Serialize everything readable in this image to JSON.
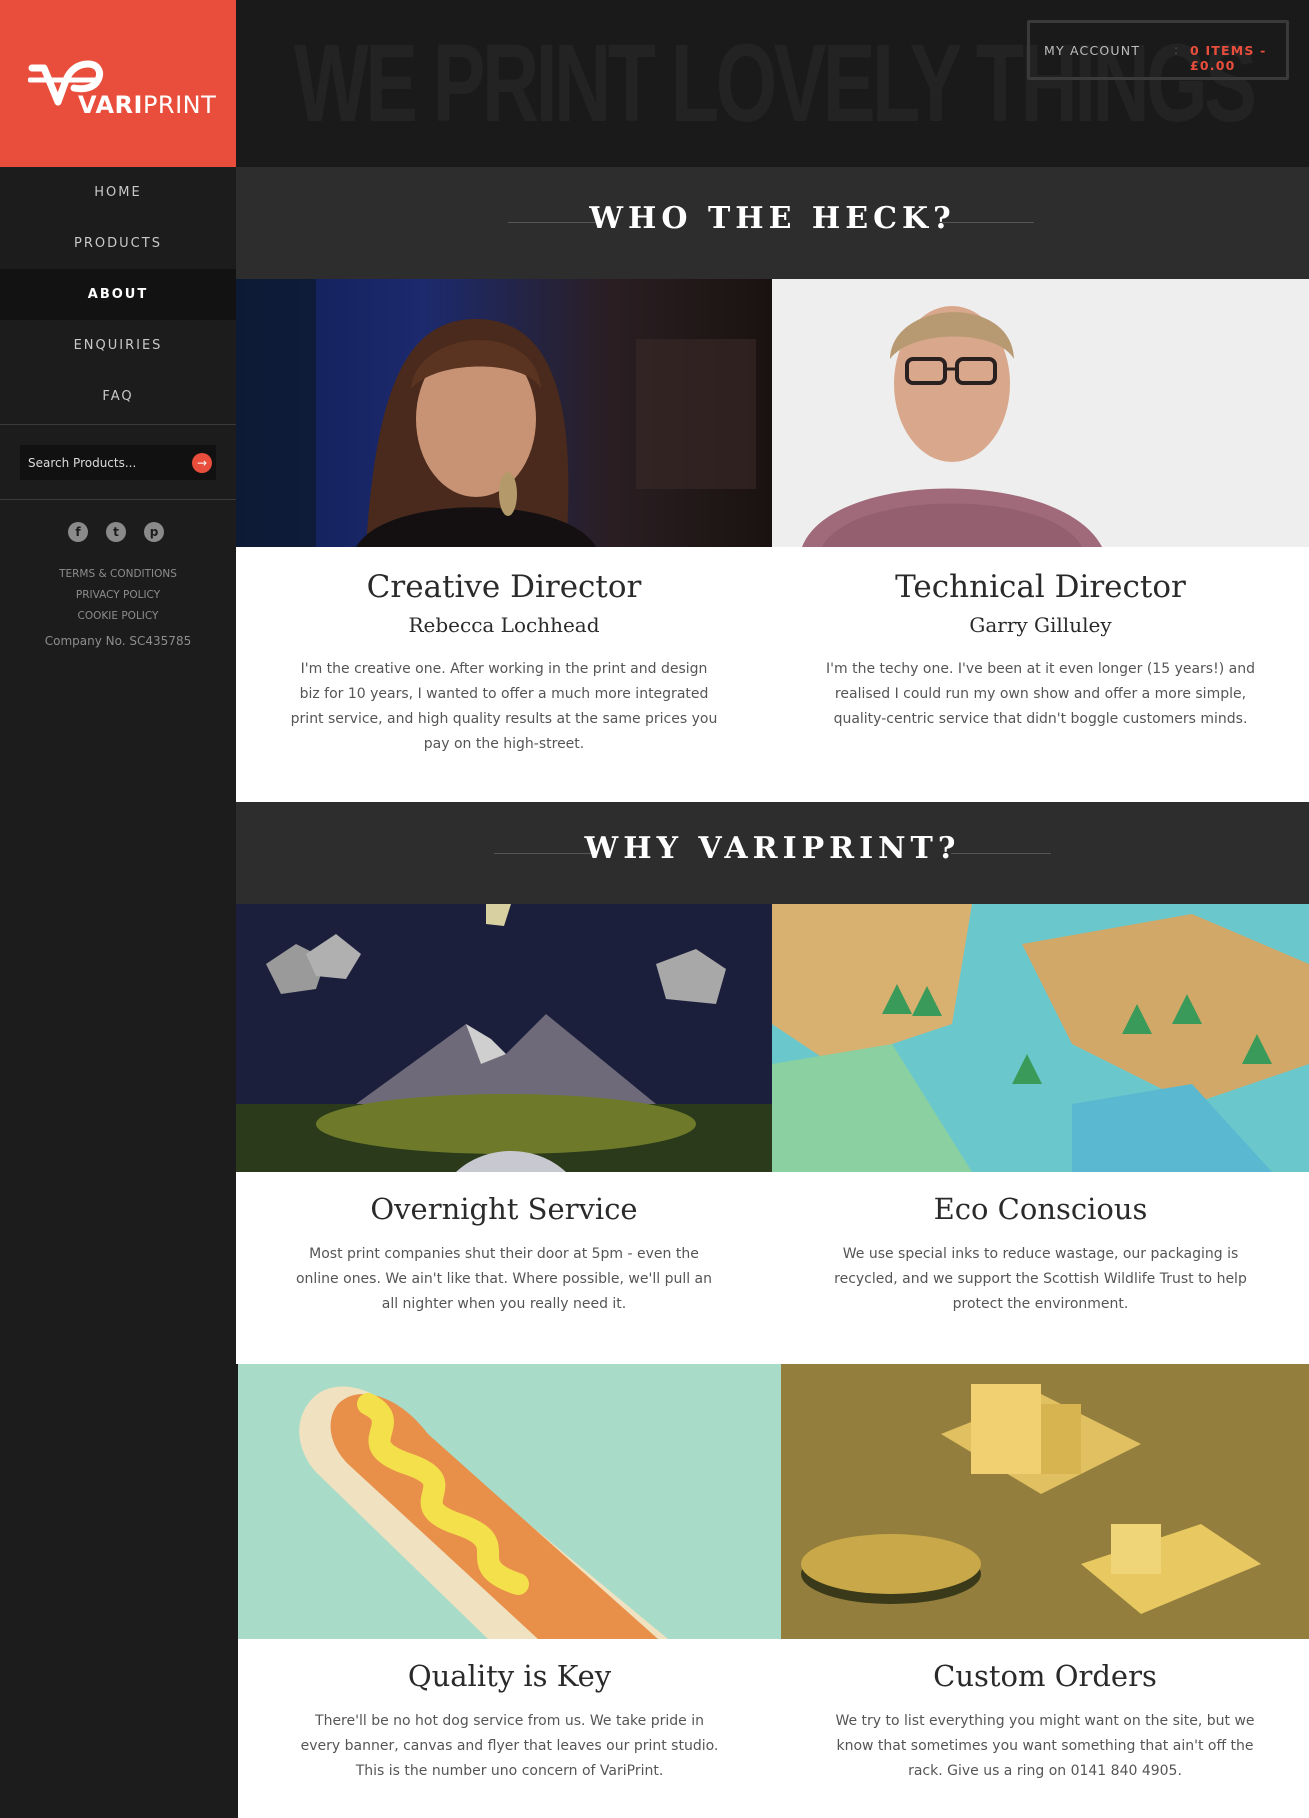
{
  "brand": {
    "logo_bold": "VARI",
    "logo_light": "PRINT",
    "accent": "#e94e3c"
  },
  "header": {
    "tagline": "WE PRINT LOVELY THINGS",
    "my_account": "MY ACCOUNT",
    "separator": ":",
    "cart": "0 ITEMS - £0.00"
  },
  "nav": {
    "items": [
      {
        "label": "HOME"
      },
      {
        "label": "PRODUCTS"
      },
      {
        "label": "ABOUT"
      },
      {
        "label": "ENQUIRIES"
      },
      {
        "label": "FAQ"
      }
    ],
    "active": "ABOUT"
  },
  "search": {
    "placeholder": "Search Products...",
    "icon": "arrow-right-icon"
  },
  "social": [
    {
      "icon": "facebook-icon",
      "glyph": "f"
    },
    {
      "icon": "twitter-icon",
      "glyph": "t"
    },
    {
      "icon": "pinterest-icon",
      "glyph": "p"
    }
  ],
  "legal": {
    "terms": "TERMS & CONDITIONS",
    "privacy": "PRIVACY POLICY",
    "cookie": "COOKIE POLICY",
    "company_no": "Company No. SC435785"
  },
  "about": {
    "heading": "WHO THE HECK?",
    "people": [
      {
        "title": "Creative Director",
        "name": "Rebecca Lochhead",
        "bio": "I'm the creative one. After working in the print and design biz for 10 years, I wanted to offer a much more integrated print service, and high quality results at the same prices you pay on the high-street."
      },
      {
        "title": "Technical Director",
        "name": "Garry Gilluley",
        "bio": "I'm the techy one. I've been at it even longer (15 years!) and realised I could run my own show and offer a more simple, quality-centric service that didn't boggle customers minds."
      }
    ]
  },
  "why": {
    "heading": "WHY VARIPRINT?",
    "features": [
      {
        "title": "Overnight Service",
        "text": "Most print companies shut their door at 5pm - even the online ones. We ain't like that. Where possible, we'll pull an all nighter when you really need it."
      },
      {
        "title": "Eco Conscious",
        "text": "We use special inks to reduce wastage, our packaging is recycled, and we support the Scottish Wildlife Trust to help protect the environment."
      },
      {
        "title": "Quality is Key",
        "text": "There'll be no hot dog service from us. We take pride in every banner, canvas and flyer that leaves our print studio. This is the number uno concern of VariPrint."
      },
      {
        "title": "Custom Orders",
        "text": "We try to list everything you might want on the site, but we know that sometimes you want something that ain't off the rack. Give us a ring on 0141 840 4905."
      }
    ]
  }
}
